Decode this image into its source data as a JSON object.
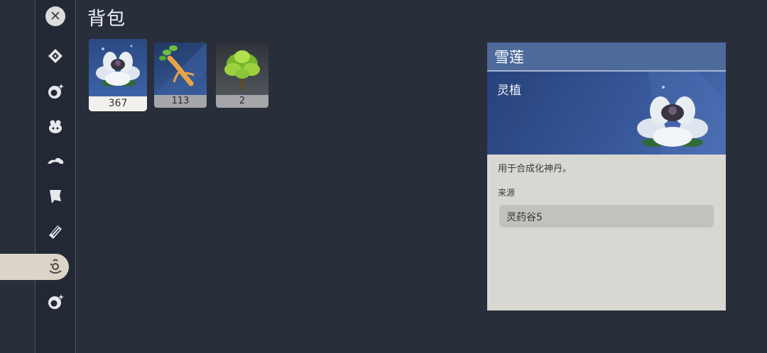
{
  "page": {
    "title": "背包"
  },
  "sidebar": {
    "items": [
      {
        "name": "close-icon"
      },
      {
        "name": "diamond-icon"
      },
      {
        "name": "sparkle-orb-icon"
      },
      {
        "name": "spirit-beast-icon"
      },
      {
        "name": "cloud-icon"
      },
      {
        "name": "flag-icon"
      },
      {
        "name": "scroll-icon"
      },
      {
        "name": "treasure-icon",
        "active": true
      },
      {
        "name": "sparkle-orb-icon"
      }
    ]
  },
  "inventory": {
    "slots": [
      {
        "item": "snow-lotus",
        "count": "367",
        "selected": true
      },
      {
        "item": "ginseng-root",
        "count": "113"
      },
      {
        "item": "green-herb",
        "count": "2"
      }
    ]
  },
  "detail": {
    "name": "雪莲",
    "type": "灵植",
    "description": "用于合成化神丹。",
    "source_label": "来源",
    "source_value": "灵药谷5"
  },
  "colors": {
    "background": "#282f3b",
    "sidebar": "#222935",
    "accent_blue": "#4d6a9b",
    "panel": "#d9d7d1",
    "active_tab": "#dcd3c9"
  }
}
